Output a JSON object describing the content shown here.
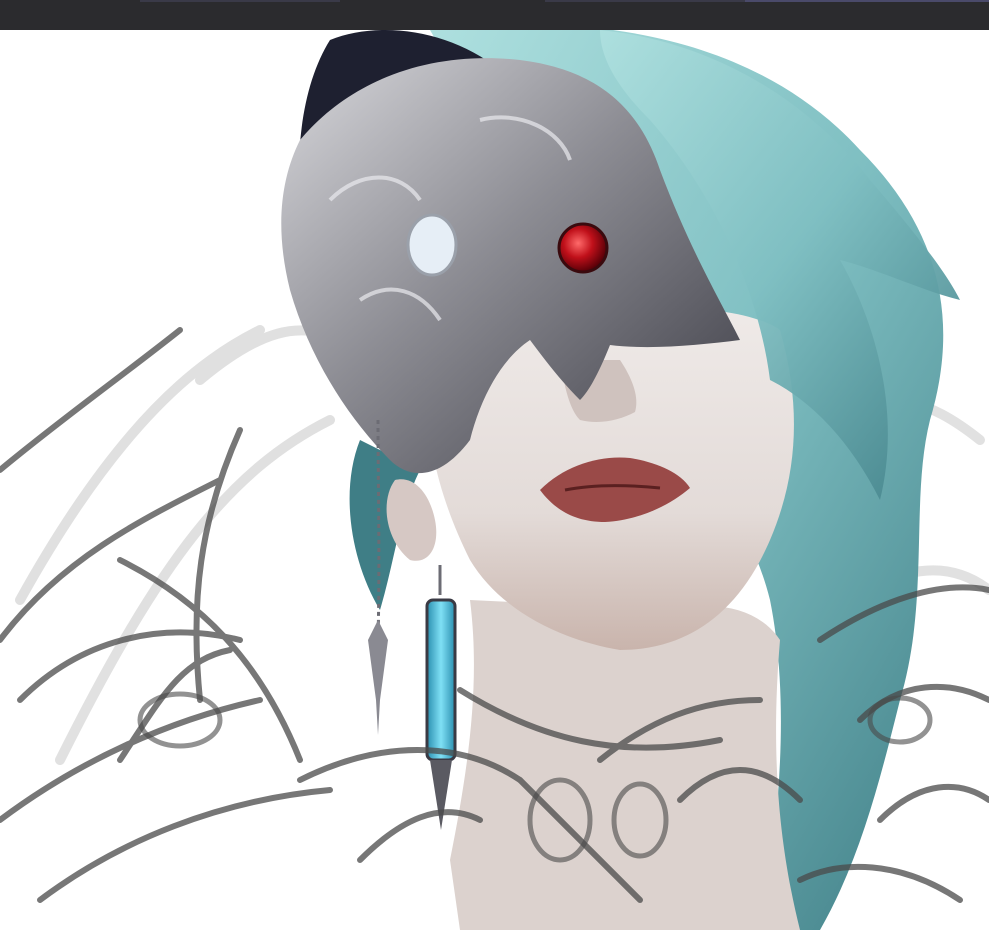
{
  "app": {
    "toolbar": "drawing-app-toolbar"
  },
  "artwork": {
    "subject": "portrait",
    "colors": {
      "background": "#ffffff",
      "toolbar": "#2b2b2e",
      "hair": "#7fbfc2",
      "hair_shadow": "#3f7e86",
      "skin": "#ece6e3",
      "skin_shadow": "#c9bdbb",
      "lips": "#9a4a48",
      "mask_silver": "#a9a9ad",
      "mask_dark": "#2e2e36",
      "gem_red": "#c0101a",
      "earring_blue": "#45b6d8",
      "sketch_stroke": "#4a4a4a",
      "sketch_light": "#cfcfcf"
    }
  }
}
